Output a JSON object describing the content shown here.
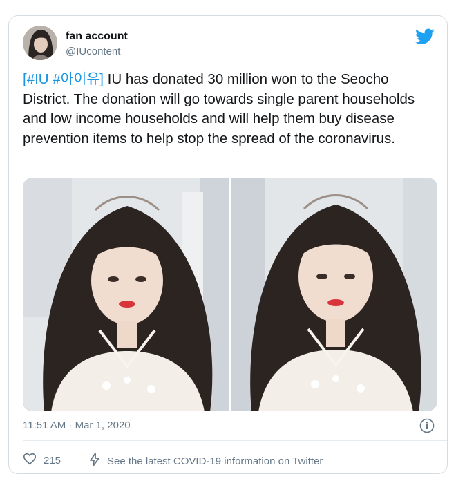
{
  "user": {
    "name": "fan account",
    "handle": "@IUcontent"
  },
  "tweet": {
    "hashtags": "[#IU #아이유]",
    "text": " IU has donated 30 million won to the Seocho District. The donation will go towards single parent households and low income households and will help them buy disease prevention items to help stop the spread of the coronavirus."
  },
  "meta": {
    "timestamp": "11:51 AM · Mar 1, 2020"
  },
  "actions": {
    "likes_count": "215",
    "covid_link": "See the latest COVID-19 information on Twitter"
  },
  "colors": {
    "twitter_blue": "#1da1f2",
    "hashtag_blue": "#1b95e0",
    "secondary_text": "#657786"
  },
  "icons": [
    "twitter-bird-icon",
    "info-icon",
    "heart-icon",
    "lightning-icon"
  ]
}
